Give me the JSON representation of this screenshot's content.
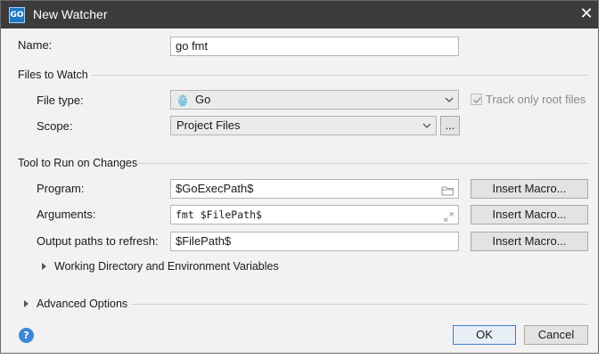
{
  "window": {
    "title": "New Watcher",
    "icon_text": "GO",
    "close_glyph": "✕"
  },
  "name": {
    "label": "Name:",
    "value": "go fmt"
  },
  "files_to_watch": {
    "section_title": "Files to Watch",
    "file_type_label": "File type:",
    "file_type_value": "Go",
    "track_root_label": "Track only root files",
    "track_root_checked": true,
    "scope_label": "Scope:",
    "scope_value": "Project Files",
    "scope_more_label": "..."
  },
  "tool": {
    "section_title": "Tool to Run on Changes",
    "program_label": "Program:",
    "program_value": "$GoExecPath$",
    "arguments_label": "Arguments:",
    "arguments_value": "fmt $FilePath$",
    "output_label": "Output paths to refresh:",
    "output_value": "$FilePath$",
    "insert_macro_label": "Insert Macro...",
    "working_dir_label": "Working Directory and Environment Variables"
  },
  "advanced": {
    "label": "Advanced Options"
  },
  "footer": {
    "help_glyph": "?",
    "ok_label": "OK",
    "cancel_label": "Cancel"
  },
  "colors": {
    "titlebar": "#3c3c3c",
    "dialog_bg": "#f2f2f2",
    "accent": "#3b7fd1"
  }
}
